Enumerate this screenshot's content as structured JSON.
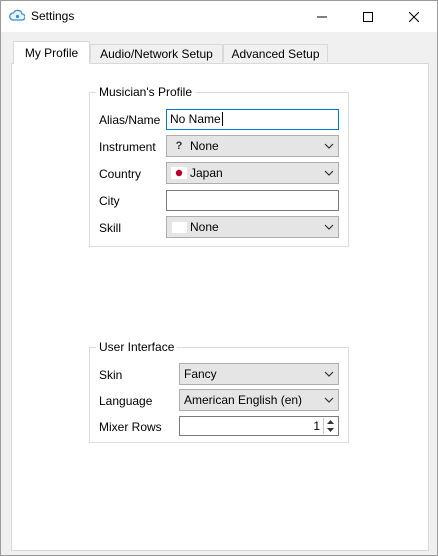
{
  "window": {
    "title": "Settings"
  },
  "tabs": [
    {
      "label": "My Profile"
    },
    {
      "label": "Audio/Network Setup"
    },
    {
      "label": "Advanced Setup"
    }
  ],
  "profile": {
    "group_title": "Musician's Profile",
    "alias_label": "Alias/Name",
    "alias_value": "No Name",
    "instrument_label": "Instrument",
    "instrument_value": "None",
    "country_label": "Country",
    "country_value": "Japan",
    "city_label": "City",
    "city_value": "",
    "skill_label": "Skill",
    "skill_value": "None"
  },
  "ui": {
    "group_title": "User Interface",
    "skin_label": "Skin",
    "skin_value": "Fancy",
    "language_label": "Language",
    "language_value": "American English (en)",
    "mixer_rows_label": "Mixer Rows",
    "mixer_rows_value": "1"
  },
  "colors": {
    "focus_border": "#0078d7",
    "japan_flag_red": "#bc002d"
  }
}
